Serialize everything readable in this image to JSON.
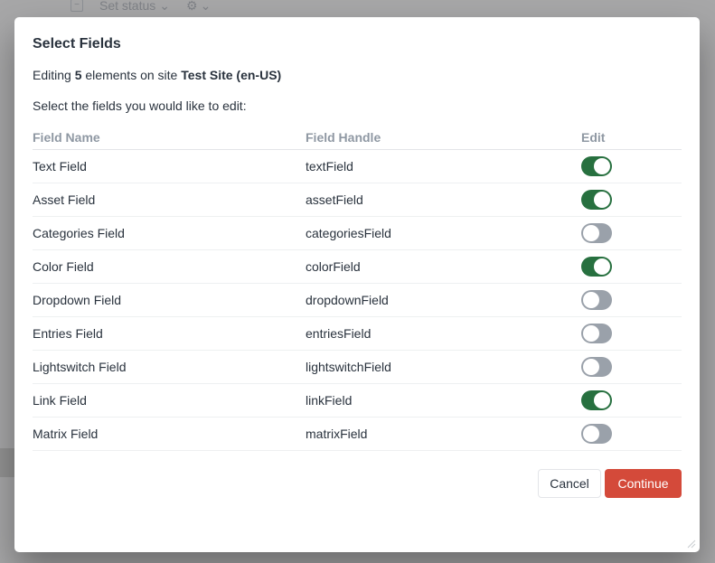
{
  "background": {
    "toolbar": {
      "checkbox_glyph": "−",
      "status_label": "Set status",
      "status_chevron": "⌄",
      "gear_glyph": "⚙",
      "gear_chevron": "⌄"
    }
  },
  "modal": {
    "title": "Select Fields",
    "editing": {
      "prefix": "Editing ",
      "count": "5",
      "middle": " elements on site ",
      "site": "Test Site (en-US)"
    },
    "instruction": "Select the fields you would like to edit:",
    "columns": {
      "name": "Field Name",
      "handle": "Field Handle",
      "edit": "Edit"
    },
    "rows": [
      {
        "name": "Text Field",
        "handle": "textField",
        "edit": true
      },
      {
        "name": "Asset Field",
        "handle": "assetField",
        "edit": true
      },
      {
        "name": "Categories Field",
        "handle": "categoriesField",
        "edit": false
      },
      {
        "name": "Color Field",
        "handle": "colorField",
        "edit": true
      },
      {
        "name": "Dropdown Field",
        "handle": "dropdownField",
        "edit": false
      },
      {
        "name": "Entries Field",
        "handle": "entriesField",
        "edit": false
      },
      {
        "name": "Lightswitch Field",
        "handle": "lightswitchField",
        "edit": false
      },
      {
        "name": "Link Field",
        "handle": "linkField",
        "edit": true
      },
      {
        "name": "Matrix Field",
        "handle": "matrixField",
        "edit": false
      }
    ],
    "buttons": {
      "cancel": "Cancel",
      "continue": "Continue"
    }
  },
  "colors": {
    "switch_on": "#27703f",
    "switch_off": "#9aa1aa",
    "primary_button": "#d44a3a",
    "header_text": "#8f98a3"
  },
  "icons": {
    "resize": "resize-handle-icon",
    "gear": "gear-icon",
    "chevron": "chevron-down-icon"
  }
}
